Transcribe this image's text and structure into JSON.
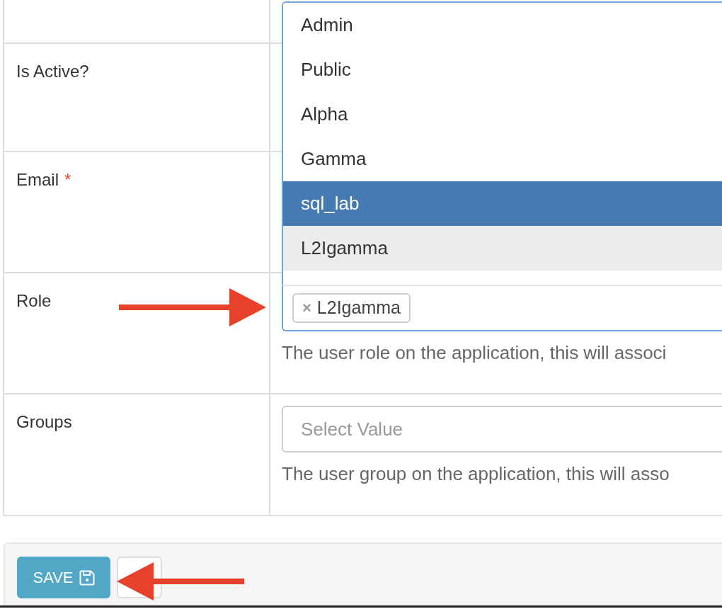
{
  "form": {
    "rows": [
      {
        "kind": "blank"
      },
      {
        "kind": "covered",
        "label": "Is Active?"
      },
      {
        "kind": "covered",
        "label": "Email",
        "required_marker": "*"
      },
      {
        "kind": "multiselect",
        "label": "Role",
        "field": {
          "open": true,
          "options": [
            {
              "label": "Admin",
              "highlighted": false,
              "selected": false
            },
            {
              "label": "Public",
              "highlighted": false,
              "selected": false
            },
            {
              "label": "Alpha",
              "highlighted": false,
              "selected": false
            },
            {
              "label": "Gamma",
              "highlighted": false,
              "selected": false
            },
            {
              "label": "sql_lab",
              "highlighted": true,
              "selected": false
            },
            {
              "label": "L2Igamma",
              "highlighted": false,
              "selected": true
            }
          ],
          "tags": [
            {
              "label": "L2Igamma",
              "remove": "×"
            }
          ],
          "help": "The user role on the application, this will associ"
        }
      },
      {
        "kind": "select",
        "label": "Groups",
        "field": {
          "placeholder": "Select Value",
          "help": "The user group on the application, this will asso"
        }
      }
    ]
  },
  "actions": [
    {
      "kind": "primary",
      "label": "SAVE"
    },
    {
      "kind": "blank"
    }
  ]
}
